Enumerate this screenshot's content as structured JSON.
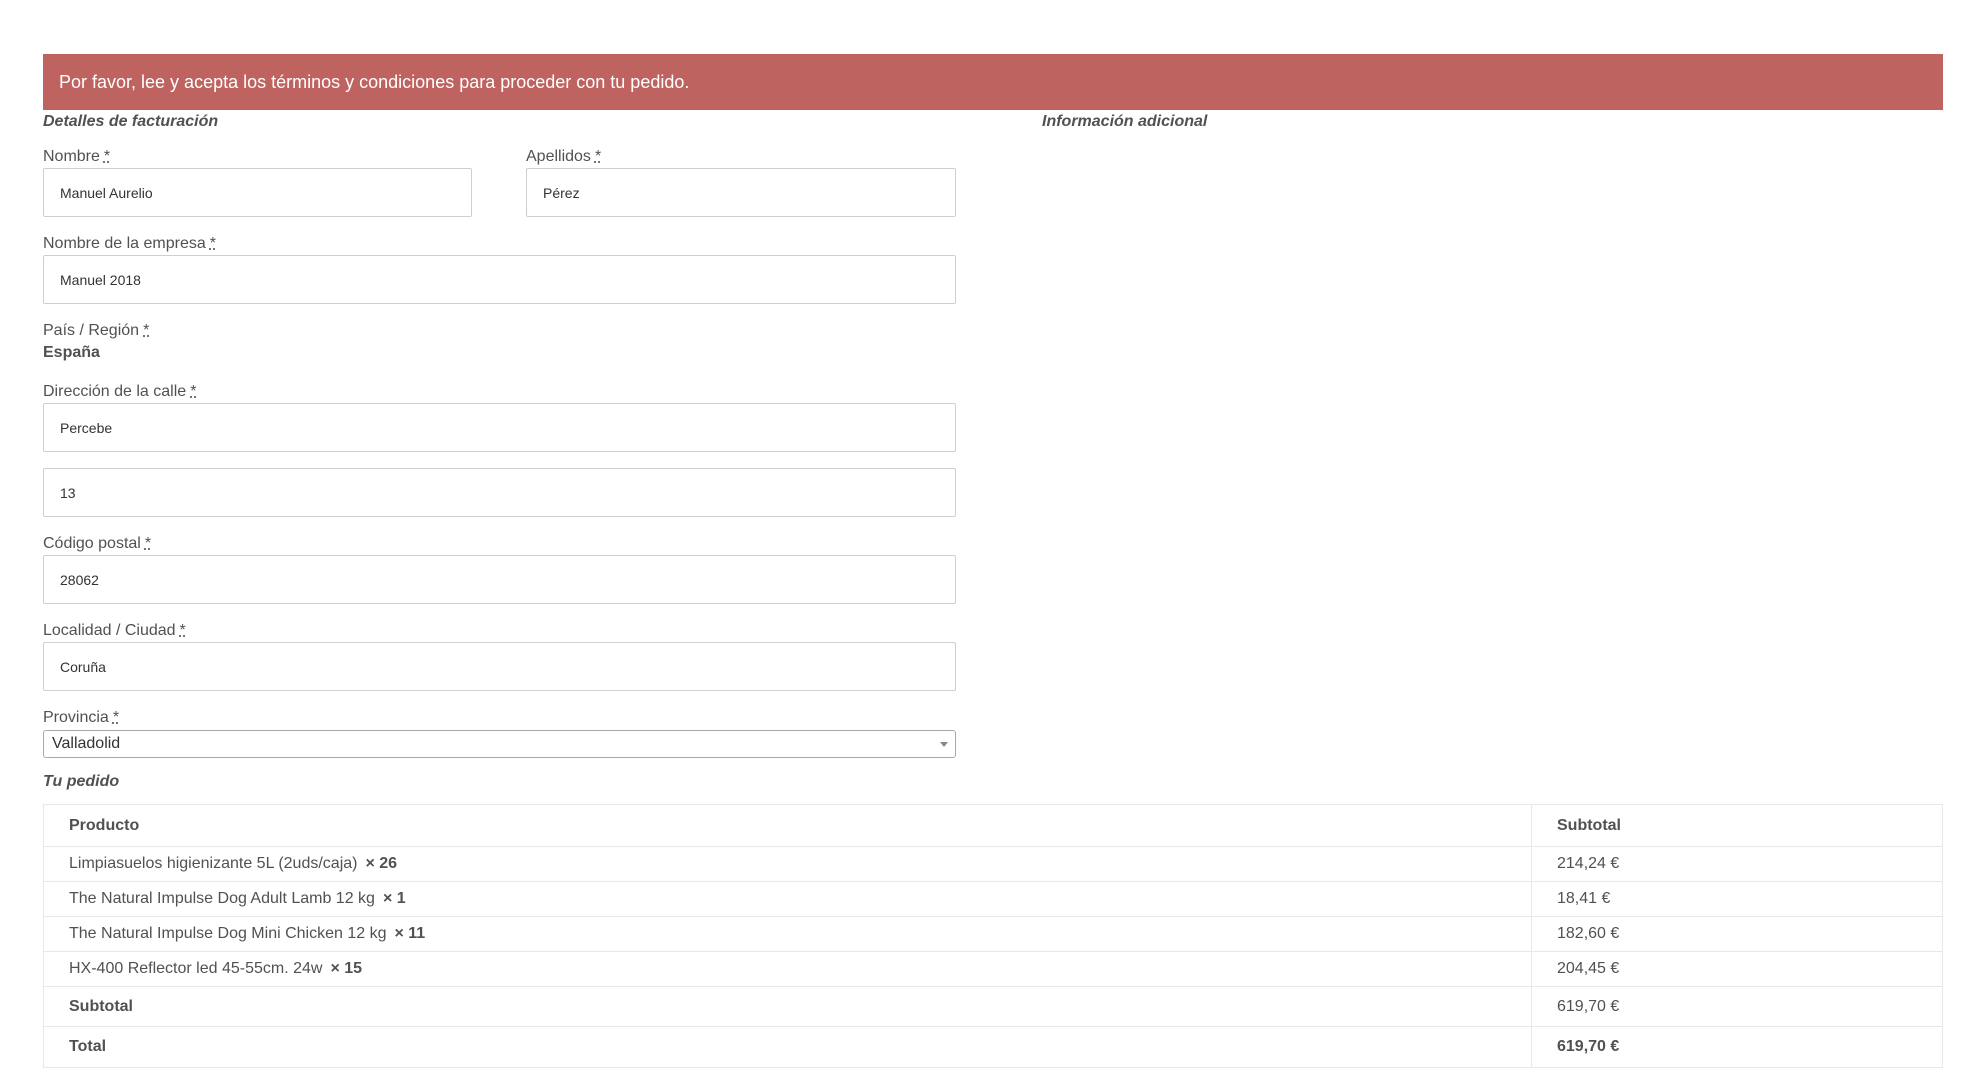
{
  "notice": "Por favor, lee y acepta los términos y condiciones para proceder con tu pedido.",
  "billing": {
    "title": "Detalles de facturación",
    "required_mark": "*",
    "first_name": {
      "label": "Nombre",
      "value": "Manuel Aurelio"
    },
    "last_name": {
      "label": "Apellidos",
      "value": "Pérez"
    },
    "company": {
      "label": "Nombre de la empresa",
      "value": "Manuel 2018"
    },
    "country": {
      "label": "País / Región",
      "value": "España"
    },
    "street": {
      "label": "Dirección de la calle",
      "value": "Percebe",
      "value2": "13"
    },
    "postcode": {
      "label": "Código postal",
      "value": "28062"
    },
    "city": {
      "label": "Localidad / Ciudad",
      "value": "Coruña"
    },
    "province": {
      "label": "Provincia",
      "value": "Valladolid"
    }
  },
  "additional": {
    "title": "Información adicional"
  },
  "order": {
    "title": "Tu pedido",
    "headers": {
      "product": "Producto",
      "subtotal": "Subtotal"
    },
    "items": [
      {
        "name": "Limpiasuelos higienizante 5L (2uds/caja)",
        "qty": "× 26",
        "subtotal": "214,24 €"
      },
      {
        "name": "The Natural Impulse Dog Adult Lamb 12 kg",
        "qty": "× 1",
        "subtotal": "18,41 €"
      },
      {
        "name": "The Natural Impulse Dog Mini Chicken 12 kg",
        "qty": "× 11",
        "subtotal": "182,60 €"
      },
      {
        "name": "HX-400 Reflector led 45-55cm. 24w",
        "qty": "× 15",
        "subtotal": "204,45 €"
      }
    ],
    "subtotal": {
      "label": "Subtotal",
      "value": "619,70 €"
    },
    "total": {
      "label": "Total",
      "value": "619,70 €"
    }
  }
}
